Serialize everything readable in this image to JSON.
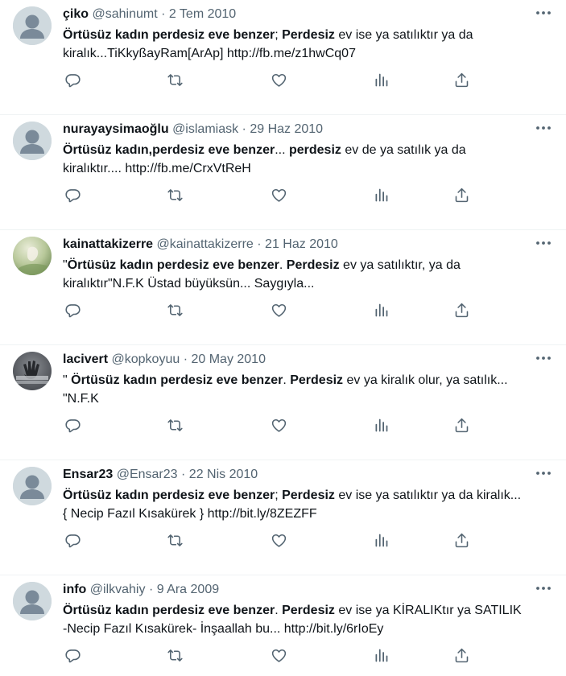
{
  "colors": {
    "text": "#0f1419",
    "muted": "#536471",
    "border": "#eff3f4",
    "avatar_default": "#cfd9de"
  },
  "icons": {
    "reply": "reply-icon",
    "retweet": "retweet-icon",
    "like": "heart-icon",
    "views": "views-icon",
    "share": "share-icon",
    "more": "more-icon"
  },
  "tweets": [
    {
      "name": "çiko",
      "handle": "@sahinumt",
      "date": "2 Tem 2010",
      "avatar": "default",
      "segments": [
        {
          "text": "Örtüsüz kadın perdesiz eve benzer",
          "bold": true
        },
        {
          "text": "; ",
          "bold": false
        },
        {
          "text": "Perdesiz",
          "bold": true
        },
        {
          "text": " ev ise ya satılıktır ya da kiralık...TiKkyßayRam[ArAp] http://fb.me/z1hwCq07",
          "bold": false
        }
      ]
    },
    {
      "name": "nurayaysimaoğlu",
      "handle": "@islamiask",
      "date": "29 Haz 2010",
      "avatar": "default",
      "segments": [
        {
          "text": "Örtüsüz kadın,perdesiz eve benzer",
          "bold": true
        },
        {
          "text": "... ",
          "bold": false
        },
        {
          "text": "perdesiz",
          "bold": true
        },
        {
          "text": " ev de ya satılık ya da kiralıktır.... http://fb.me/CrxVtReH",
          "bold": false
        }
      ]
    },
    {
      "name": "kainattakizerre",
      "handle": "@kainattakizerre",
      "date": "21 Haz 2010",
      "avatar": "photo-green",
      "segments": [
        {
          "text": "\"",
          "bold": false
        },
        {
          "text": "Örtüsüz kadın perdesiz eve benzer",
          "bold": true
        },
        {
          "text": ". ",
          "bold": false
        },
        {
          "text": "Perdesiz",
          "bold": true
        },
        {
          "text": " ev ya satılıktır, ya da kiralıktır\"N.F.K   Üstad büyüksün... Saygıyla...",
          "bold": false
        }
      ]
    },
    {
      "name": "lacivert",
      "handle": "@kopkoyuu",
      "date": "20 May 2010",
      "avatar": "photo-dark",
      "segments": [
        {
          "text": "\" ",
          "bold": false
        },
        {
          "text": "Örtüsüz kadın perdesiz eve benzer",
          "bold": true
        },
        {
          "text": ". ",
          "bold": false
        },
        {
          "text": "Perdesiz",
          "bold": true
        },
        {
          "text": " ev ya kiralık olur, ya satılık... \"N.F.K",
          "bold": false
        }
      ]
    },
    {
      "name": "Ensar23",
      "handle": "@Ensar23",
      "date": "22 Nis 2010",
      "avatar": "default",
      "segments": [
        {
          "text": "Örtüsüz kadın perdesiz eve benzer",
          "bold": true
        },
        {
          "text": "; ",
          "bold": false
        },
        {
          "text": "Perdesiz",
          "bold": true
        },
        {
          "text": " ev ise ya satılıktır ya da kiralık... { Necip Fazıl Kısakürek } http://bit.ly/8ZEZFF",
          "bold": false
        }
      ]
    },
    {
      "name": "info",
      "handle": "@ilkvahiy",
      "date": "9 Ara 2009",
      "avatar": "default",
      "segments": [
        {
          "text": "Örtüsüz kadın perdesiz eve benzer",
          "bold": true
        },
        {
          "text": ". ",
          "bold": false
        },
        {
          "text": "Perdesiz",
          "bold": true
        },
        {
          "text": " ev ise ya KİRALIKtır ya SATILIK -Necip Fazıl Kısakürek- İnşaallah bu... http://bit.ly/6rIoEy",
          "bold": false
        }
      ]
    }
  ]
}
